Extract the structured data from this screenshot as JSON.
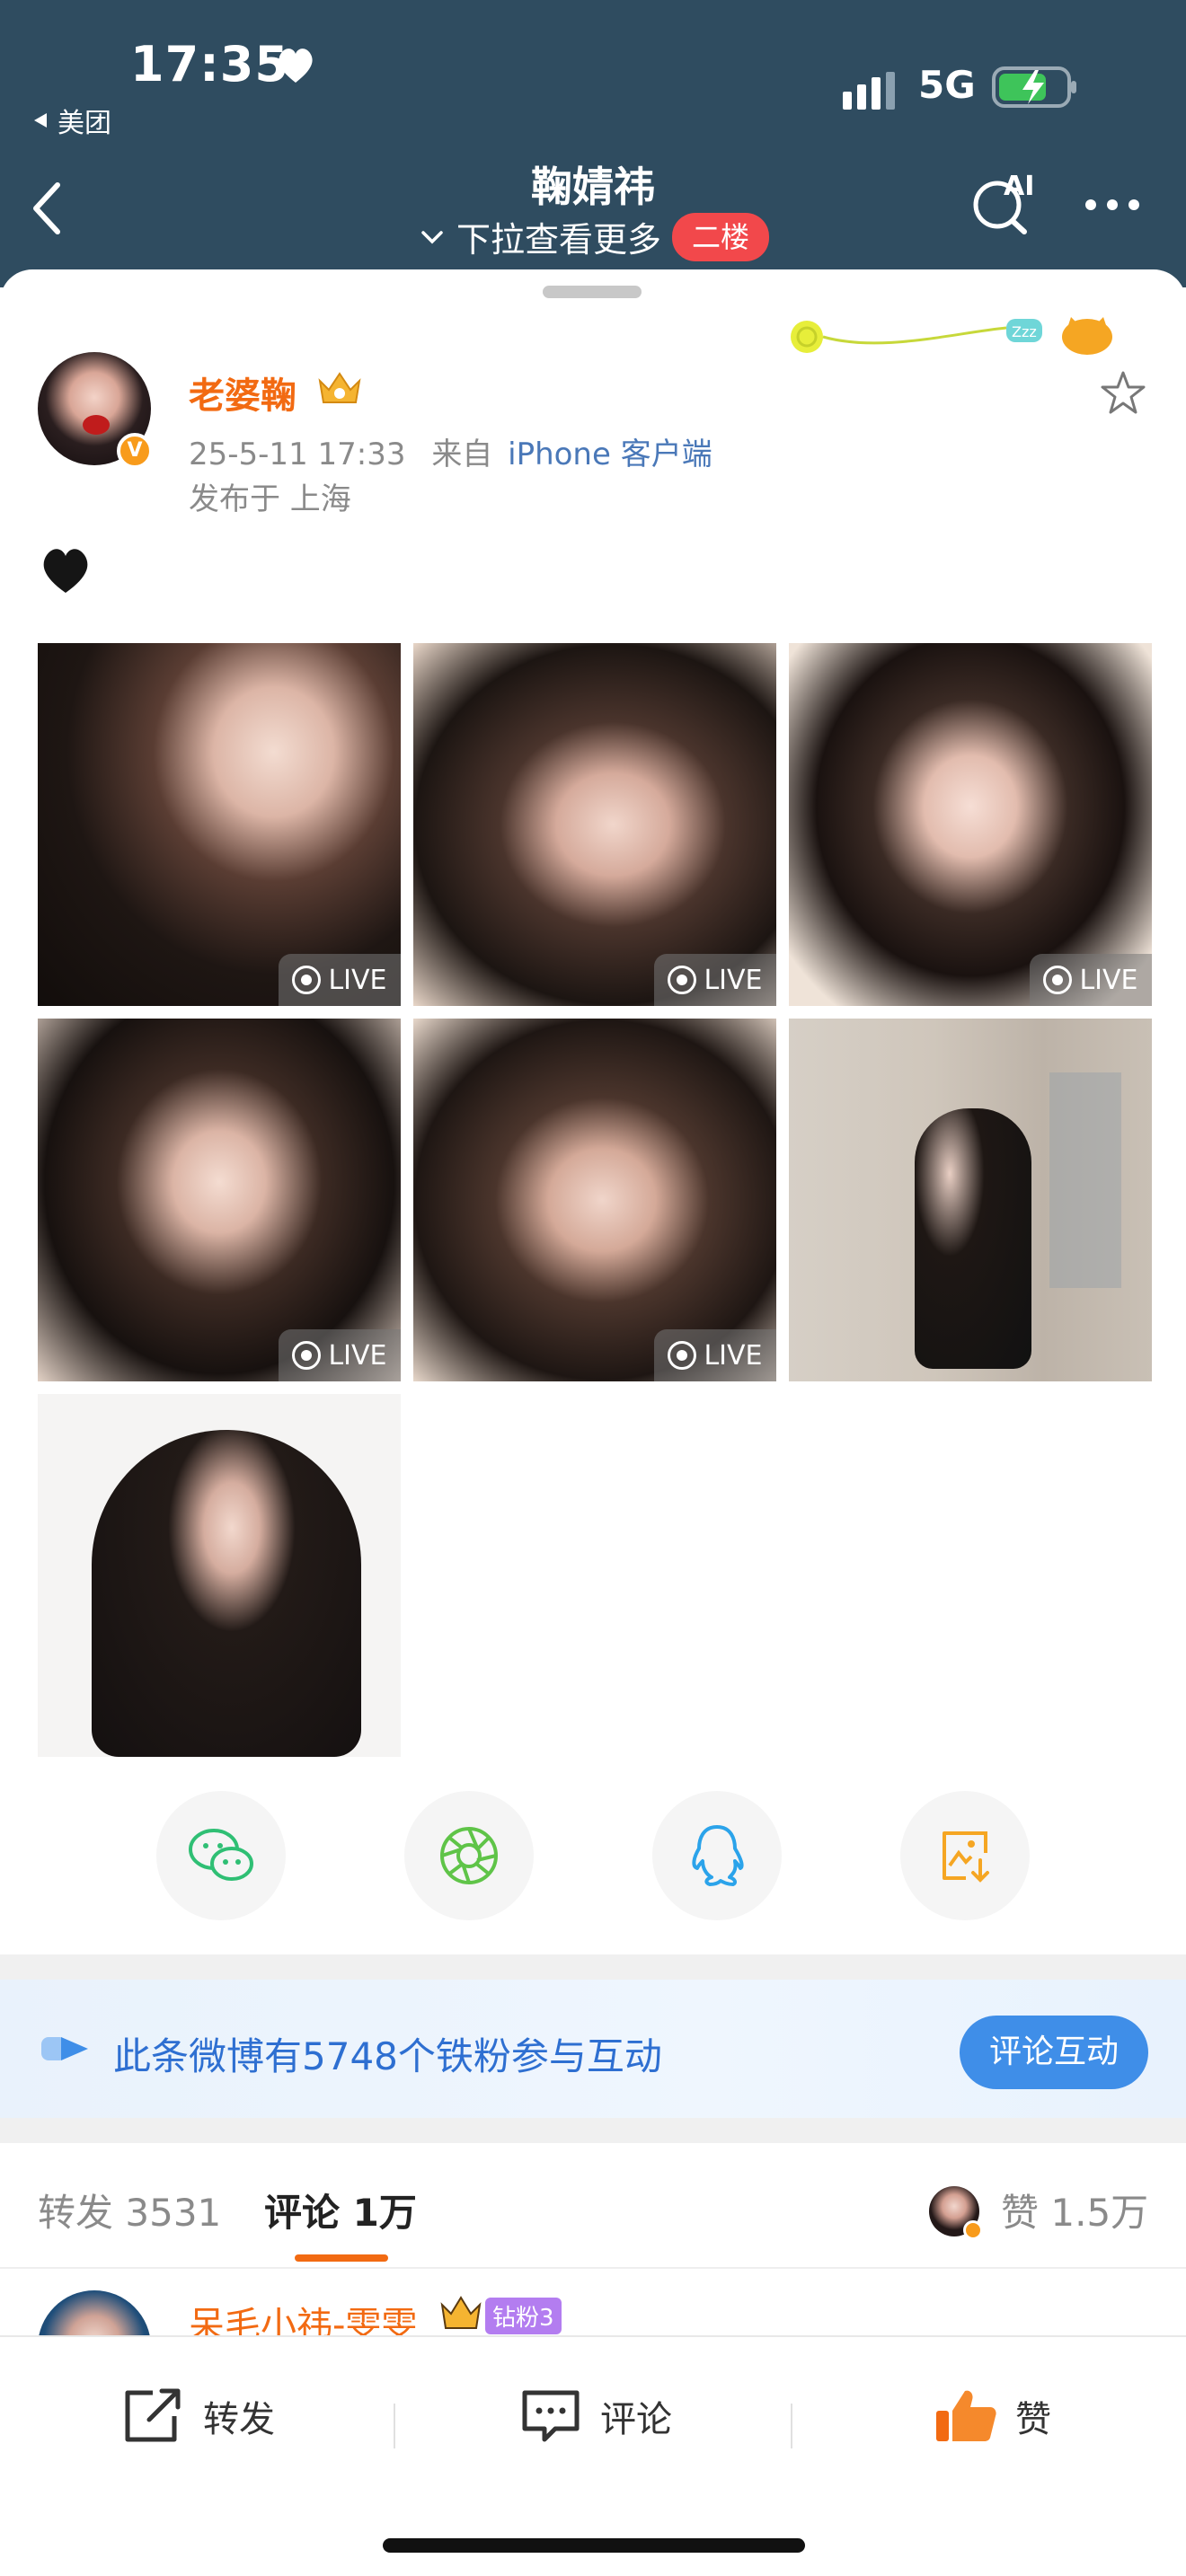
{
  "status_bar": {
    "time": "17:35",
    "network": "5G",
    "back_app": "美团"
  },
  "header": {
    "title": "鞠婧祎",
    "subtitle": "下拉查看更多",
    "badge": "二楼",
    "ai_label": "AI"
  },
  "post": {
    "author": "老婆鞠",
    "timestamp": "25-5-11 17:33",
    "source": "来自",
    "source_app": "iPhone 客户端",
    "location": "发布于 上海",
    "photos": [
      {
        "live": "LIVE"
      },
      {
        "live": "LIVE"
      },
      {
        "live": "LIVE"
      },
      {
        "live": "LIVE"
      },
      {
        "live": "LIVE"
      },
      {
        "live": ""
      },
      {
        "live": ""
      }
    ]
  },
  "share": {
    "buttons": [
      "wechat-icon",
      "moments-icon",
      "qq-icon",
      "save-image-icon"
    ]
  },
  "banner": {
    "text": "此条微博有5748个铁粉参与互动",
    "button": "评论互动"
  },
  "tabs": {
    "repost_label": "转发",
    "repost_count": "3531",
    "comment_label": "评论",
    "comment_count": "1万",
    "like_label": "赞",
    "like_count": "1.5万"
  },
  "comment_preview": {
    "name": "呆毛小祎-雯雯",
    "fan_badge": "钻粉3"
  },
  "bottom_bar": {
    "repost": "转发",
    "comment": "评论",
    "like": "赞"
  },
  "colors": {
    "header_bg": "#2f4c60",
    "accent_orange": "#f26a12",
    "link_blue": "#4a78b8",
    "banner_blue": "#3f8ee8",
    "badge_red": "#f2484b"
  }
}
